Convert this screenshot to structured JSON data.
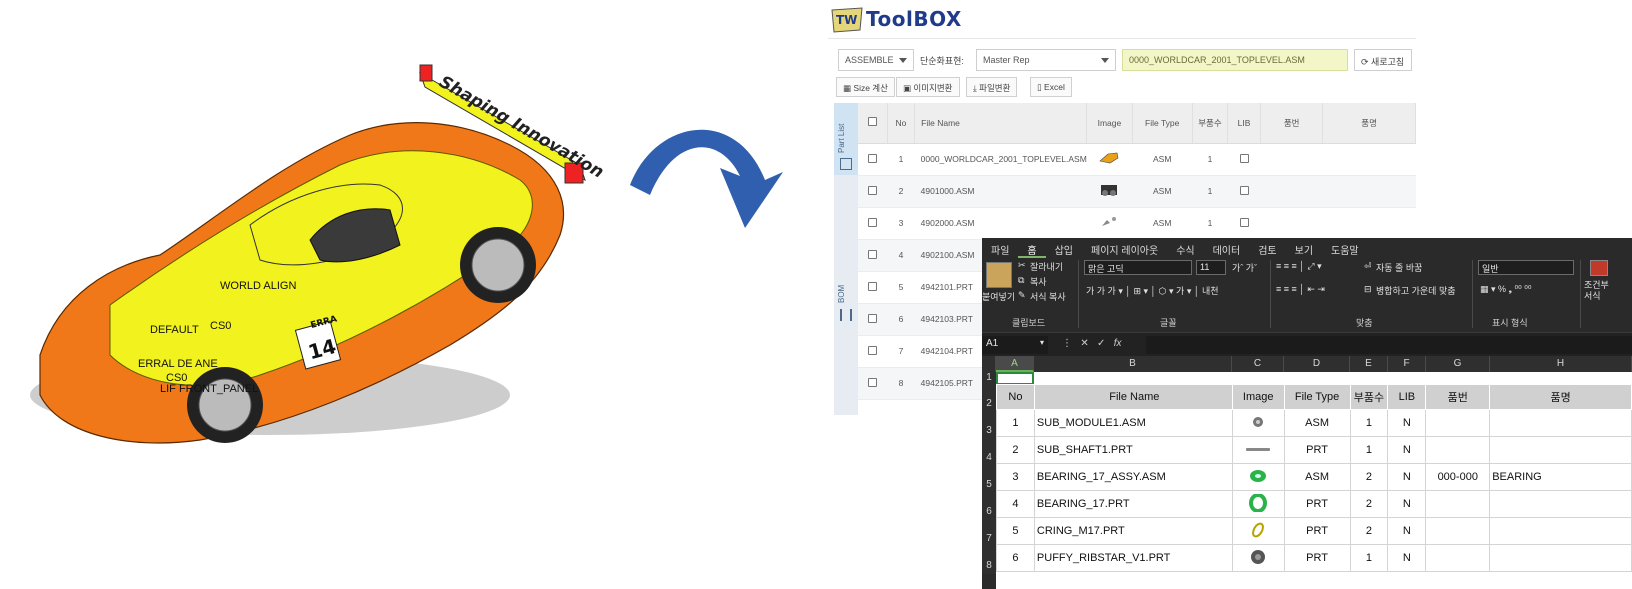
{
  "colors": {
    "toolbox_blue": "#1f3b8a",
    "car_orange": "#f07818",
    "car_yellow": "#f2f21e",
    "arrow_blue": "#2f5fae",
    "excel_ribbon": "#2a2a2a",
    "excel_selection": "#2c8a3c"
  },
  "car": {
    "wing_text": "Shaping Innovation",
    "number": "14",
    "tag": "ERRA",
    "labels": [
      "WORLD ALIGN",
      "DEFAULT",
      "CS0",
      "ERRAL DE ANE",
      "CS0",
      "LIF FRONT_PANEL"
    ]
  },
  "toolbox": {
    "logo_text": "ToolBOX",
    "mode": "ASSEMBLE",
    "simplify_label": "단순화표현:",
    "rep": "Master Rep",
    "toplevel": "0000_WORLDCAR_2001_TOPLEVEL.ASM",
    "refresh": "새로고침",
    "buttons": {
      "size": "Size 계산",
      "image": "이미지변환",
      "file": "파일변환",
      "excel": "Excel"
    },
    "side": {
      "part": "Part List",
      "bom": "BOM"
    },
    "columns": [
      "No",
      "File Name",
      "Image",
      "File Type",
      "부품수",
      "LIB",
      "품번",
      "품명"
    ],
    "rows": [
      {
        "no": "1",
        "name": "0000_WORLDCAR_2001_TOPLEVEL.ASM",
        "type": "ASM",
        "qty": "1"
      },
      {
        "no": "2",
        "name": "4901000.ASM",
        "type": "ASM",
        "qty": "1"
      },
      {
        "no": "3",
        "name": "4902000.ASM",
        "type": "ASM",
        "qty": "1"
      },
      {
        "no": "4",
        "name": "4902100.ASM",
        "type": "",
        "qty": ""
      },
      {
        "no": "5",
        "name": "4942101.PRT",
        "type": "",
        "qty": ""
      },
      {
        "no": "6",
        "name": "4942103.PRT",
        "type": "",
        "qty": ""
      },
      {
        "no": "7",
        "name": "4942104.PRT",
        "type": "",
        "qty": ""
      },
      {
        "no": "8",
        "name": "4942105.PRT",
        "type": "",
        "qty": ""
      }
    ]
  },
  "excel": {
    "tabs": [
      "파일",
      "홈",
      "삽입",
      "페이지 레이아웃",
      "수식",
      "데이터",
      "검토",
      "보기",
      "도움말"
    ],
    "active_tab": "홈",
    "clipboard": {
      "paste": "붙여넣기",
      "cut": "잘라내기",
      "copy": "복사",
      "format_painter": "서식 복사",
      "group": "클립보드"
    },
    "font": {
      "name": "맑은 고딕",
      "size": "11",
      "group": "글꼴"
    },
    "alignment": {
      "wrap": "자동 줄 바꿈",
      "merge": "병합하고 가운데 맞춤",
      "group": "맞춤"
    },
    "number": {
      "format": "일반",
      "group": "표시 형식"
    },
    "conditional": "조건부\n서식",
    "namebox": "A1",
    "col_letters": [
      "A",
      "B",
      "C",
      "D",
      "E",
      "F",
      "G",
      "H"
    ],
    "row_numbers": [
      "1",
      "2",
      "3",
      "4",
      "5",
      "6",
      "7",
      "8"
    ],
    "headers": [
      "No",
      "File Name",
      "Image",
      "File Type",
      "부품수",
      "LIB",
      "품번",
      "품명"
    ],
    "rows": [
      {
        "no": "1",
        "name": "SUB_MODULE1.ASM",
        "type": "ASM",
        "qty": "1",
        "lib": "N",
        "pn": "",
        "desc": ""
      },
      {
        "no": "2",
        "name": "SUB_SHAFT1.PRT",
        "type": "PRT",
        "qty": "1",
        "lib": "N",
        "pn": "",
        "desc": ""
      },
      {
        "no": "3",
        "name": "BEARING_17_ASSY.ASM",
        "type": "ASM",
        "qty": "2",
        "lib": "N",
        "pn": "000-000",
        "desc": "BEARING"
      },
      {
        "no": "4",
        "name": "BEARING_17.PRT",
        "type": "PRT",
        "qty": "2",
        "lib": "N",
        "pn": "",
        "desc": ""
      },
      {
        "no": "5",
        "name": "CRING_M17.PRT",
        "type": "PRT",
        "qty": "2",
        "lib": "N",
        "pn": "",
        "desc": ""
      },
      {
        "no": "6",
        "name": "PUFFY_RIBSTAR_V1.PRT",
        "type": "PRT",
        "qty": "1",
        "lib": "N",
        "pn": "",
        "desc": ""
      }
    ]
  }
}
